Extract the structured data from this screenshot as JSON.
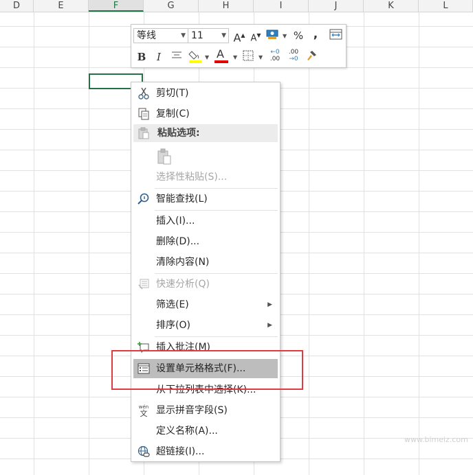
{
  "columns": [
    "D",
    "E",
    "F",
    "G",
    "H",
    "I",
    "J",
    "K",
    "L"
  ],
  "selected_column": "F",
  "mini_toolbar": {
    "font_name": "等线",
    "font_size": "11",
    "grow_font": "A",
    "shrink_font": "A",
    "percent": "%",
    "comma": ",",
    "bold": "B",
    "italic": "I",
    "font_color_glyph": "A",
    "increase_decimal": ".00",
    "decrease_decimal": ".00",
    "highlight_color": "#ffff00",
    "font_color": "#e00000"
  },
  "context_menu": {
    "cut": "剪切(T)",
    "copy": "复制(C)",
    "paste_options": "粘贴选项:",
    "paste_special": "选择性粘贴(S)...",
    "smart_lookup": "智能查找(L)",
    "insert": "插入(I)...",
    "delete": "删除(D)...",
    "clear_contents": "清除内容(N)",
    "quick_analysis": "快速分析(Q)",
    "filter": "筛选(E)",
    "sort": "排序(O)",
    "insert_comment": "插入批注(M)",
    "format_cells": "设置单元格格式(F)...",
    "pick_from_list": "从下拉列表中选择(K)...",
    "phonetic": "显示拼音字段(S)",
    "define_name": "定义名称(A)...",
    "hyperlink": "超链接(I)...",
    "phonetic_icon_text": "wén",
    "phonetic_icon_char": "文"
  },
  "watermark": "www.bimeiz.com"
}
